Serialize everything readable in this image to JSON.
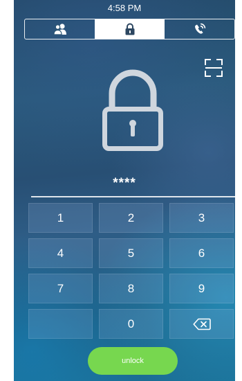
{
  "status_bar": {
    "time": "4:58 PM"
  },
  "tabs": [
    {
      "icon": "contacts-icon",
      "active": false
    },
    {
      "icon": "lock-icon",
      "active": true
    },
    {
      "icon": "phone-call-icon",
      "active": false
    }
  ],
  "scan_icon": "qr-scan-icon",
  "lock_graphic": "padlock-icon",
  "password": {
    "masked_value": "****"
  },
  "keypad": {
    "keys": [
      "1",
      "2",
      "3",
      "4",
      "5",
      "6",
      "7",
      "8",
      "9",
      "",
      "0",
      ""
    ],
    "backspace_icon": "backspace-icon"
  },
  "unlock_button": {
    "label": "unlock"
  },
  "colors": {
    "accent_green": "#77d74f",
    "tab_active_bg": "#ffffff",
    "tab_icon_dark": "#2d4761",
    "text": "#ffffff"
  }
}
